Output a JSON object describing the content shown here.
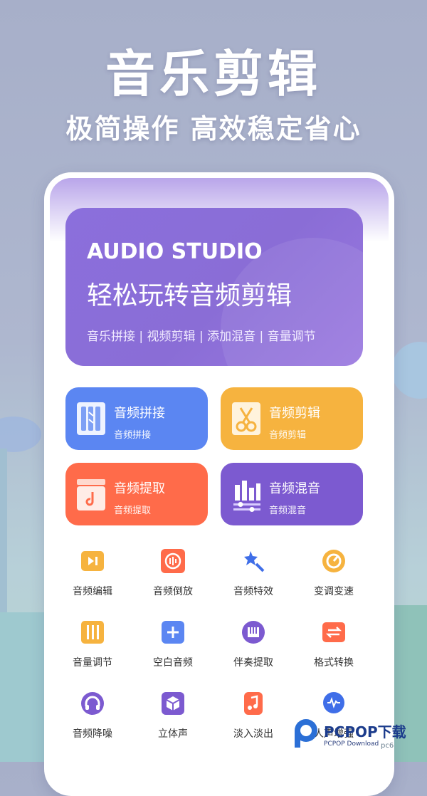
{
  "headline": "音乐剪辑",
  "subheadline": "极简操作 高效稳定省心",
  "banner": {
    "title": "AUDIO STUDIO",
    "slogan": "轻松玩转音频剪辑",
    "tags": "音乐拼接 | 视频剪辑 | 添加混音 | 音量调节"
  },
  "cards": [
    {
      "title": "音频拼接",
      "sub": "音频拼接",
      "color": "#5b86f2",
      "icon": "stack-bars-icon"
    },
    {
      "title": "音频剪辑",
      "sub": "音频剪辑",
      "color": "#f6b33f",
      "icon": "scissors-icon"
    },
    {
      "title": "音频提取",
      "sub": "音频提取",
      "color": "#ff6b4a",
      "icon": "music-box-icon"
    },
    {
      "title": "音频混音",
      "sub": "音频混音",
      "color": "#7c5ad0",
      "icon": "equalizer-icon"
    }
  ],
  "tools": [
    {
      "label": "音频编辑",
      "icon": "play-card-icon"
    },
    {
      "label": "音频倒放",
      "icon": "rewind-circle-icon"
    },
    {
      "label": "音频特效",
      "icon": "magic-wand-icon"
    },
    {
      "label": "变调变速",
      "icon": "speed-dial-icon"
    },
    {
      "label": "音量调节",
      "icon": "volume-sliders-icon"
    },
    {
      "label": "空白音频",
      "icon": "plus-square-icon"
    },
    {
      "label": "伴奏提取",
      "icon": "piano-icon"
    },
    {
      "label": "格式转换",
      "icon": "convert-icon"
    },
    {
      "label": "音频降噪",
      "icon": "headphones-icon"
    },
    {
      "label": "立体声",
      "icon": "cube-icon"
    },
    {
      "label": "淡入淡出",
      "icon": "music-note-icon"
    },
    {
      "label": "人声增强",
      "icon": "waveform-bubble-icon"
    }
  ],
  "watermark": {
    "brand": "PCPOP下载",
    "sub": "PCPOP Download",
    "corner": "pc6"
  }
}
